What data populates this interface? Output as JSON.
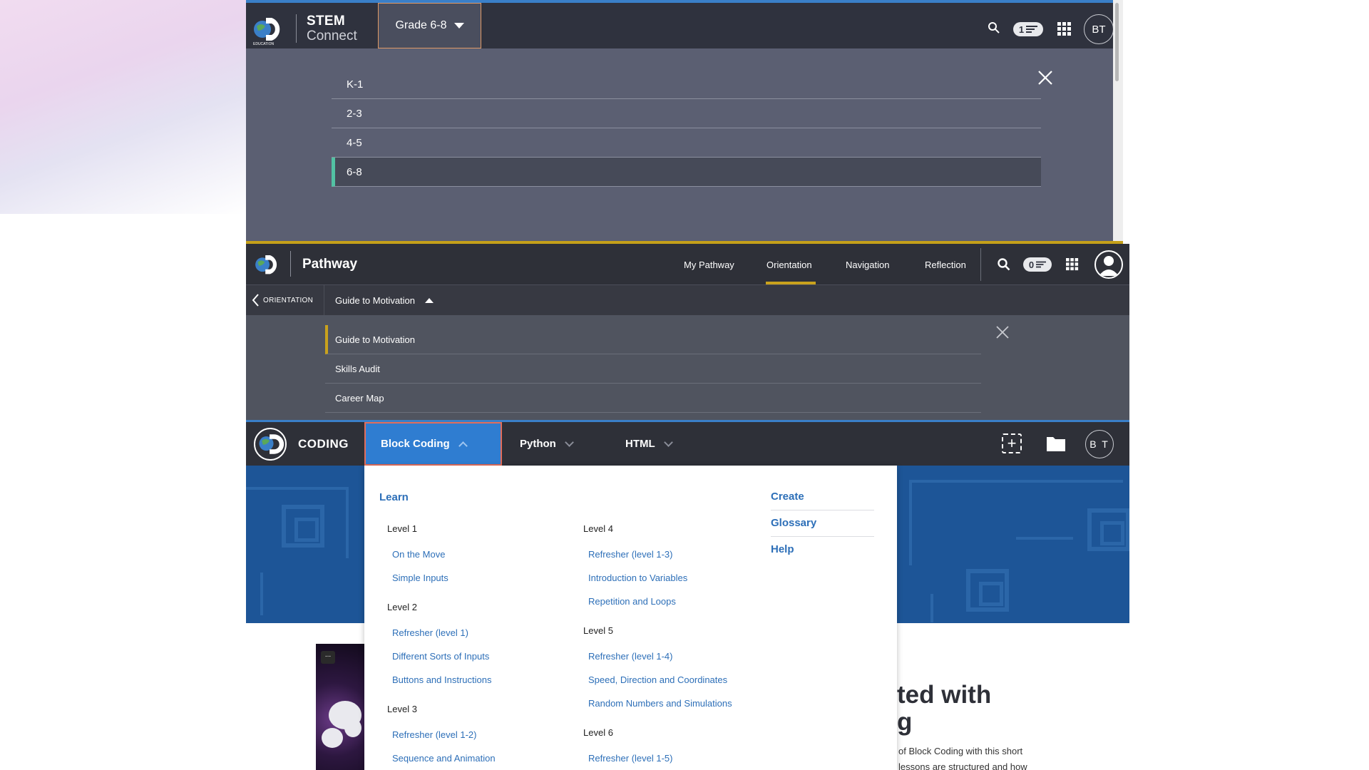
{
  "stem": {
    "brand_title": "STEM",
    "brand_sub": "Connect",
    "grade_button": "Grade 6-8",
    "badge_count": "1",
    "avatar": "BT",
    "grades": [
      "K-1",
      "2-3",
      "4-5",
      "6-8"
    ],
    "active_grade": "6-8"
  },
  "pathway": {
    "brand_title": "Pathway",
    "nav": [
      "My Pathway",
      "Orientation",
      "Navigation",
      "Reflection"
    ],
    "active_nav": "Orientation",
    "badge_count": "0",
    "back_label": "ORIENTATION",
    "dropdown_label": "Guide to Motivation",
    "items": [
      "Guide to Motivation",
      "Skills Audit",
      "Career Map"
    ]
  },
  "coding": {
    "brand_title": "CODING",
    "tabs": [
      "Block Coding",
      "Python",
      "HTML"
    ],
    "avatar": "B T",
    "menu": {
      "learn": "Learn",
      "levels": [
        {
          "name": "Level 1",
          "links": [
            "On the Move",
            "Simple Inputs"
          ]
        },
        {
          "name": "Level 2",
          "links": [
            "Refresher (level 1)",
            "Different Sorts of Inputs",
            "Buttons and Instructions"
          ]
        },
        {
          "name": "Level 3",
          "links": [
            "Refresher (level 1-2)",
            "Sequence and Animation"
          ]
        },
        {
          "name": "Level 4",
          "links": [
            "Refresher (level 1-3)",
            "Introduction to Variables",
            "Repetition and Loops"
          ]
        },
        {
          "name": "Level 5",
          "links": [
            "Refresher (level 1-4)",
            "Speed, Direction and Coordinates",
            "Random Numbers and Simulations"
          ]
        },
        {
          "name": "Level 6",
          "links": [
            "Refresher (level 1-5)"
          ]
        }
      ],
      "right": [
        "Create",
        "Glossary",
        "Help"
      ]
    },
    "thumb_menu": "...",
    "hero_line1": "ted with",
    "hero_line2": "g",
    "hero_p1": "of Block Coding with this short",
    "hero_p2": "lessons are structured and how"
  },
  "colors": {
    "accent_blue": "#2f7dd1",
    "gold": "#c9a21d",
    "teal": "#52c2a3",
    "link": "#2d6fb8"
  }
}
